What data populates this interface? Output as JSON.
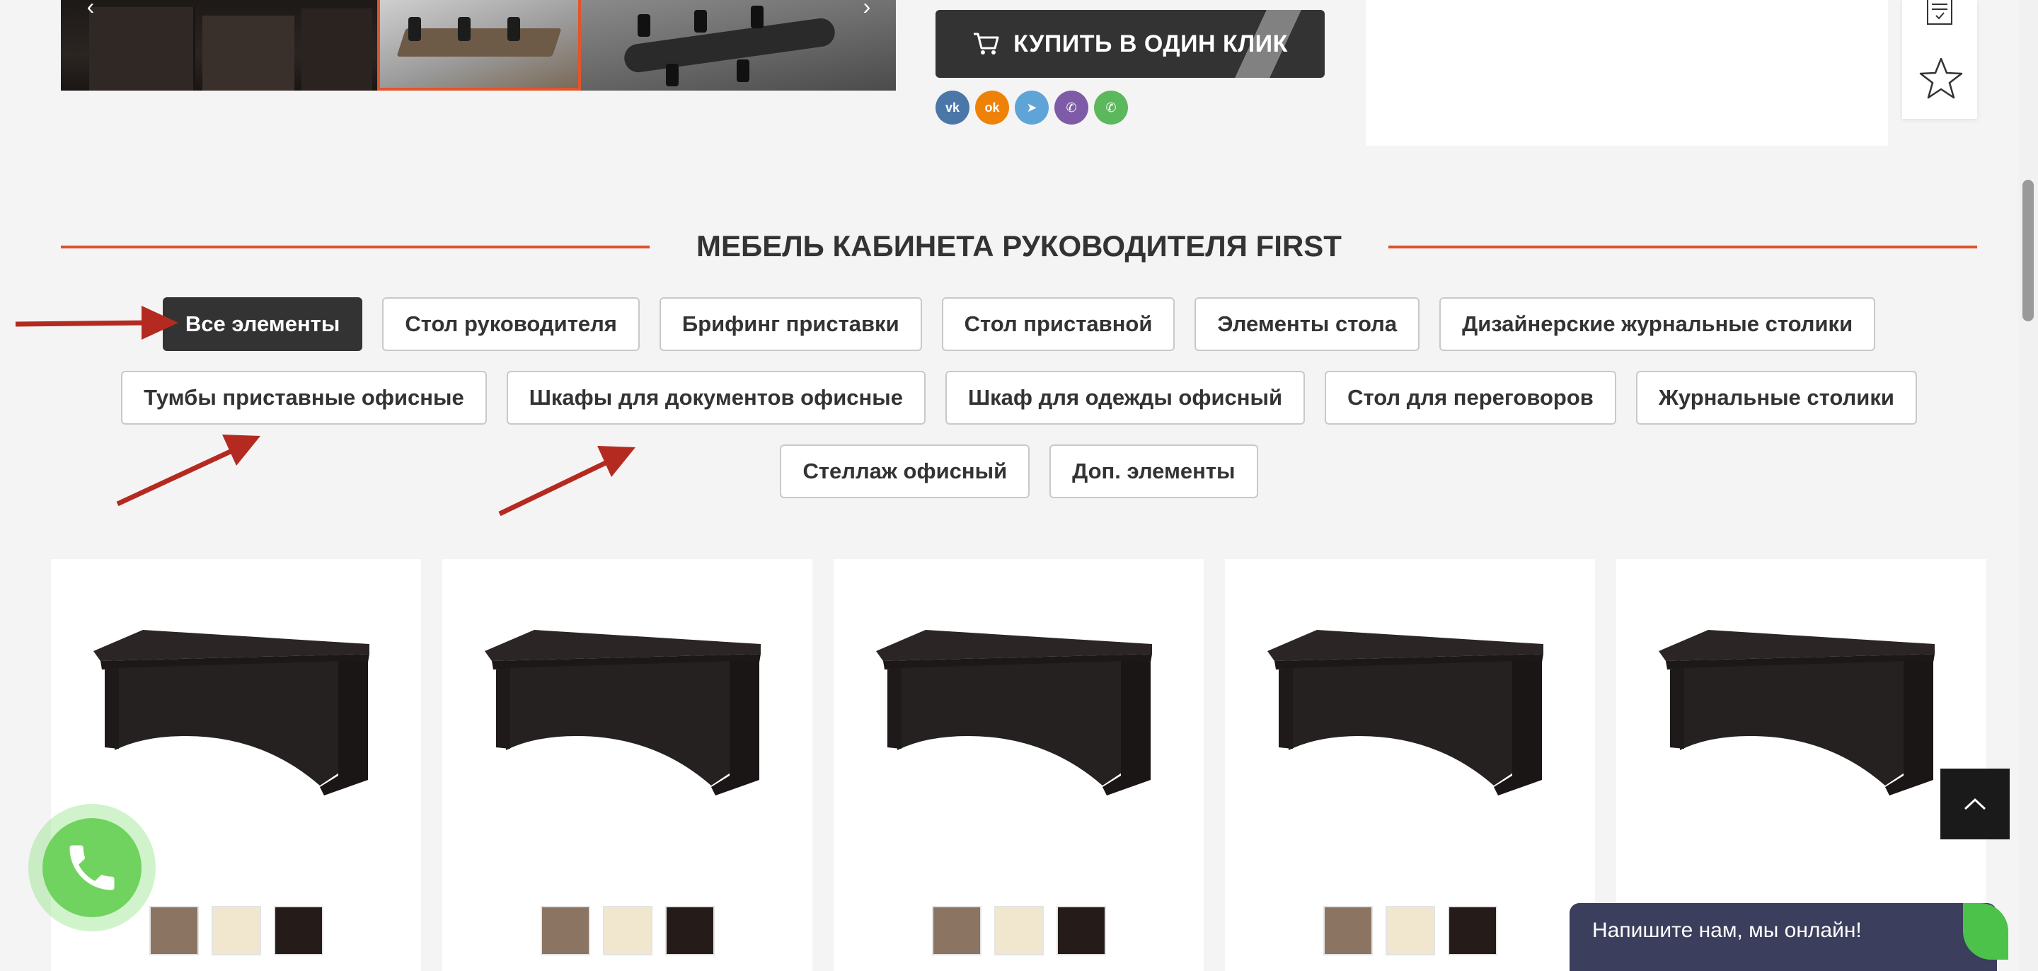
{
  "gallery": {
    "prev_icon": "chevron-left-icon",
    "next_icon": "chevron-right-icon",
    "prev_symbol": "‹",
    "next_symbol": "›"
  },
  "buy_button": {
    "label": "КУПИТЬ В ОДИН КЛИК",
    "icon": "cart-icon"
  },
  "socials": [
    {
      "name": "vk",
      "glyph": "vk",
      "color": "#4a76a8"
    },
    {
      "name": "odnoklassniki",
      "glyph": "ok",
      "color": "#ee8208"
    },
    {
      "name": "telegram",
      "glyph": "➤",
      "color": "#5fa4d6"
    },
    {
      "name": "viber",
      "glyph": "✆",
      "color": "#7d5ba6"
    },
    {
      "name": "whatsapp",
      "glyph": "✆",
      "color": "#5cb85c"
    }
  ],
  "section": {
    "title": "МЕБЕЛЬ КАБИНЕТА РУКОВОДИТЕЛЯ FIRST"
  },
  "filters": {
    "rows": [
      [
        "Все элементы",
        "Стол руководителя",
        "Брифинг приставки",
        "Стол приставной",
        "Элементы стола",
        "Дизайнерские журнальные столики"
      ],
      [
        "Тумбы приставные офисные",
        "Шкафы для документов офисные",
        "Шкаф для одежды офисный",
        "Стол для переговоров",
        "Журнальные столики"
      ],
      [
        "Стеллаж офисный",
        "Доп. элементы"
      ]
    ],
    "active": "Все элементы"
  },
  "products": {
    "count": 5,
    "swatch_colors": [
      "#8c7462",
      "#f1e7cf",
      "#251c1a"
    ],
    "swatch_names": [
      "light-wood",
      "cream",
      "dark-wenge"
    ]
  },
  "chat": {
    "label": "Напишите нам, мы онлайн!"
  },
  "colors": {
    "accent": "#d9532c",
    "dark": "#333333",
    "annotation": "#b52a20"
  }
}
